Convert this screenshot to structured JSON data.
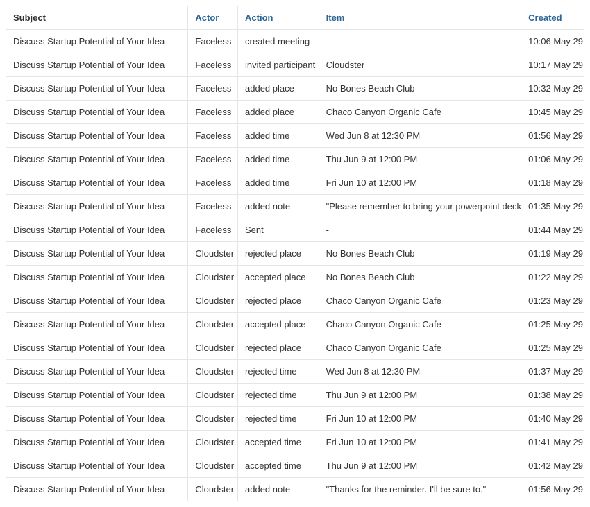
{
  "columns": {
    "subject": "Subject",
    "actor": "Actor",
    "action": "Action",
    "item": "Item",
    "created": "Created"
  },
  "rows": [
    {
      "subject": "Discuss Startup Potential of Your Idea",
      "actor": "Faceless",
      "action": "created meeting",
      "item": "-",
      "created": "10:06 May 29"
    },
    {
      "subject": "Discuss Startup Potential of Your Idea",
      "actor": "Faceless",
      "action": "invited participant",
      "item": "Cloudster",
      "created": "10:17 May 29"
    },
    {
      "subject": "Discuss Startup Potential of Your Idea",
      "actor": "Faceless",
      "action": "added place",
      "item": "No Bones Beach Club",
      "created": "10:32 May 29"
    },
    {
      "subject": "Discuss Startup Potential of Your Idea",
      "actor": "Faceless",
      "action": "added place",
      "item": "Chaco Canyon Organic Cafe",
      "created": "10:45 May 29"
    },
    {
      "subject": "Discuss Startup Potential of Your Idea",
      "actor": "Faceless",
      "action": "added time",
      "item": "Wed Jun 8 at 12:30 PM",
      "created": "01:56 May 29"
    },
    {
      "subject": "Discuss Startup Potential of Your Idea",
      "actor": "Faceless",
      "action": "added time",
      "item": "Thu Jun 9 at 12:00 PM",
      "created": "01:06 May 29"
    },
    {
      "subject": "Discuss Startup Potential of Your Idea",
      "actor": "Faceless",
      "action": "added time",
      "item": "Fri Jun 10 at 12:00 PM",
      "created": "01:18 May 29"
    },
    {
      "subject": "Discuss Startup Potential of Your Idea",
      "actor": "Faceless",
      "action": "added note",
      "item": "\"Please remember to bring your powerpoint deck.\"",
      "created": "01:35 May 29"
    },
    {
      "subject": "Discuss Startup Potential of Your Idea",
      "actor": "Faceless",
      "action": "Sent",
      "item": "-",
      "created": "01:44 May 29"
    },
    {
      "subject": "Discuss Startup Potential of Your Idea",
      "actor": "Cloudster",
      "action": "rejected place",
      "item": "No Bones Beach Club",
      "created": "01:19 May 29"
    },
    {
      "subject": "Discuss Startup Potential of Your Idea",
      "actor": "Cloudster",
      "action": "accepted place",
      "item": "No Bones Beach Club",
      "created": "01:22 May 29"
    },
    {
      "subject": "Discuss Startup Potential of Your Idea",
      "actor": "Cloudster",
      "action": "rejected place",
      "item": "Chaco Canyon Organic Cafe",
      "created": "01:23 May 29"
    },
    {
      "subject": "Discuss Startup Potential of Your Idea",
      "actor": "Cloudster",
      "action": "accepted place",
      "item": "Chaco Canyon Organic Cafe",
      "created": "01:25 May 29"
    },
    {
      "subject": "Discuss Startup Potential of Your Idea",
      "actor": "Cloudster",
      "action": "rejected place",
      "item": "Chaco Canyon Organic Cafe",
      "created": "01:25 May 29"
    },
    {
      "subject": "Discuss Startup Potential of Your Idea",
      "actor": "Cloudster",
      "action": "rejected time",
      "item": "Wed Jun 8 at 12:30 PM",
      "created": "01:37 May 29"
    },
    {
      "subject": "Discuss Startup Potential of Your Idea",
      "actor": "Cloudster",
      "action": "rejected time",
      "item": "Thu Jun 9 at 12:00 PM",
      "created": "01:38 May 29"
    },
    {
      "subject": "Discuss Startup Potential of Your Idea",
      "actor": "Cloudster",
      "action": "rejected time",
      "item": "Fri Jun 10 at 12:00 PM",
      "created": "01:40 May 29"
    },
    {
      "subject": "Discuss Startup Potential of Your Idea",
      "actor": "Cloudster",
      "action": "accepted time",
      "item": "Fri Jun 10 at 12:00 PM",
      "created": "01:41 May 29"
    },
    {
      "subject": "Discuss Startup Potential of Your Idea",
      "actor": "Cloudster",
      "action": "accepted time",
      "item": "Thu Jun 9 at 12:00 PM",
      "created": "01:42 May 29"
    },
    {
      "subject": "Discuss Startup Potential of Your Idea",
      "actor": "Cloudster",
      "action": "added note",
      "item": "\"Thanks for the reminder. I'll be sure to.\"",
      "created": "01:56 May 29"
    }
  ]
}
